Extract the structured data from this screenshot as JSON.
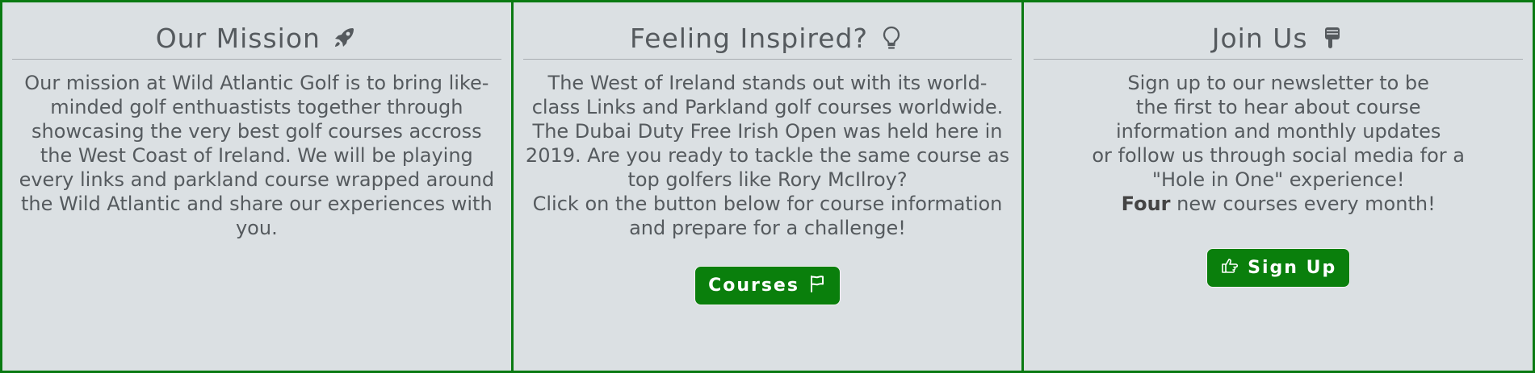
{
  "colors": {
    "card_background": "#dbe0e3",
    "border_green": "#0a7a12",
    "button_green": "#0a7f0c",
    "text_gray": "#555a5e"
  },
  "mission": {
    "title": "Our Mission",
    "icon": "rocket-icon",
    "lines": [
      "Our mission at Wild Atlantic Golf is to bring like-",
      "minded golf enthuastists together through",
      "showcasing the very best golf courses accross",
      "the West Coast of Ireland. We will be playing",
      "every links and parkland course wrapped around",
      "the Wild Atlantic and share our experiences with",
      "you."
    ]
  },
  "inspired": {
    "title": "Feeling Inspired?",
    "icon": "lightbulb-icon",
    "lines": [
      "The West of Ireland stands out with its world-",
      "class Links and Parkland golf courses worldwide.",
      "The Dubai Duty Free Irish Open was held here in",
      "2019. Are you ready to tackle the same course as",
      "top golfers like Rory McIlroy?",
      "Click on the button below for course information",
      "and prepare for a challenge!"
    ],
    "button_label": "Courses",
    "button_icon": "flag-icon"
  },
  "join": {
    "title": "Join Us",
    "icon": "hand-point-down-icon",
    "lines": [
      "Sign up to our newsletter to be",
      "the first to hear about course",
      "information and monthly updates",
      "or follow us through social media for a",
      "\"Hole in One\" experience!"
    ],
    "last_line_strong": "Four",
    "last_line_rest": " new courses every month!",
    "button_label": "Sign Up",
    "button_icon": "hand-point-right-icon"
  }
}
